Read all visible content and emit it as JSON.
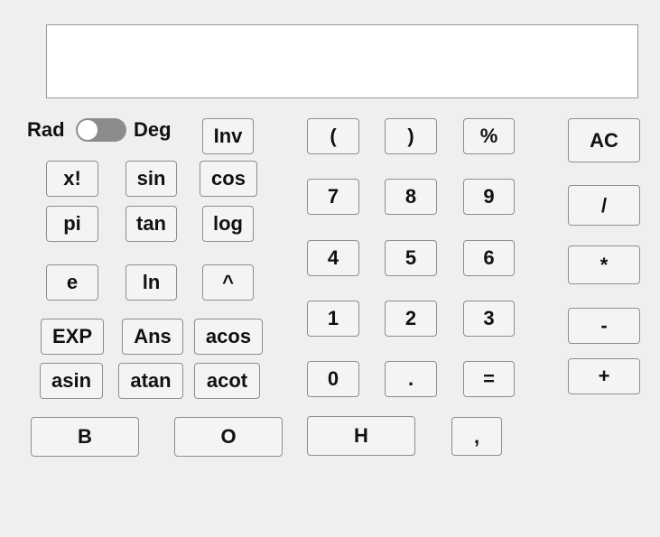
{
  "display": {
    "value": ""
  },
  "angle_mode": {
    "left_label": "Rad",
    "right_label": "Deg",
    "selected": "Rad"
  },
  "sci": {
    "inv": "Inv",
    "fact": "x!",
    "sin": "sin",
    "cos": "cos",
    "pi": "pi",
    "tan": "tan",
    "log": "log",
    "e": "e",
    "ln": "ln",
    "pow": "^",
    "exp": "EXP",
    "ans": "Ans",
    "acos": "acos",
    "asin": "asin",
    "atan": "atan",
    "acot": "acot"
  },
  "keypad": {
    "lparen": "(",
    "rparen": ")",
    "percent": "%",
    "n7": "7",
    "n8": "8",
    "n9": "9",
    "n4": "4",
    "n5": "5",
    "n6": "6",
    "n1": "1",
    "n2": "2",
    "n3": "3",
    "n0": "0",
    "dot": ".",
    "equals": "="
  },
  "ops": {
    "ac": "AC",
    "div": "/",
    "mul": "*",
    "sub": "-",
    "add": "+"
  },
  "bases": {
    "b": "B",
    "o": "O",
    "h": "H",
    "comma": ","
  }
}
